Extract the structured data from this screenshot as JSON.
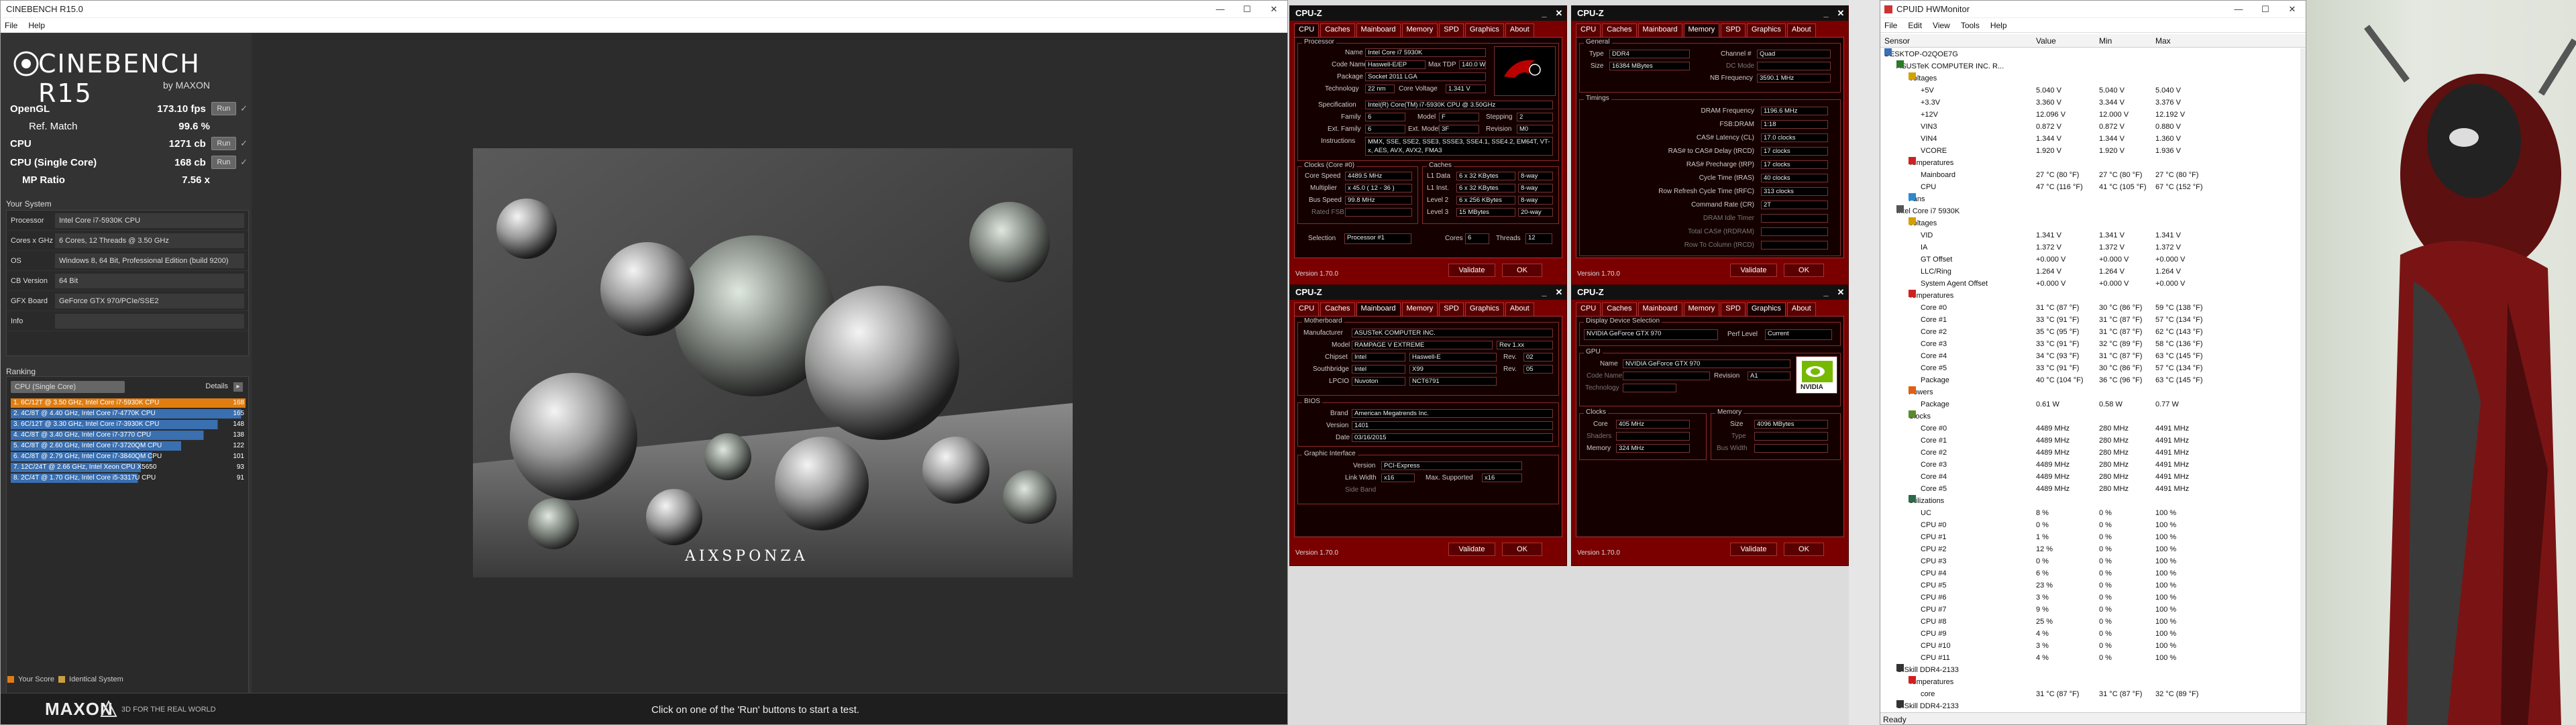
{
  "cinebench": {
    "title": "CINEBENCH R15.0",
    "menu": [
      "File",
      "Help"
    ],
    "logo_main": "CINEBENCH R15",
    "logo_sub": "by MAXON",
    "scores": [
      {
        "label": "OpenGL",
        "value": "173.10 fps",
        "run": "Run"
      },
      {
        "label": "Ref. Match",
        "value": "99.6 %",
        "run": ""
      },
      {
        "label": "CPU",
        "value": "1271 cb",
        "run": "Run"
      },
      {
        "label": "CPU (Single Core)",
        "value": "168 cb",
        "run": "Run"
      },
      {
        "label": "MP Ratio",
        "value": "7.56 x",
        "run": ""
      }
    ],
    "system_header": "Your System",
    "system": [
      {
        "k": "Processor",
        "v": "Intel Core i7-5930K CPU"
      },
      {
        "k": "Cores x GHz",
        "v": "6 Cores, 12 Threads @ 3.50 GHz"
      },
      {
        "k": "OS",
        "v": "Windows 8, 64 Bit, Professional Edition (build 9200)"
      },
      {
        "k": "CB Version",
        "v": "64 Bit"
      },
      {
        "k": "GFX Board",
        "v": "GeForce GTX 970/PCIe/SSE2"
      },
      {
        "k": "Info",
        "v": ""
      }
    ],
    "ranking_header": "Ranking",
    "ranking_select": "CPU (Single Core)",
    "ranking_details": "Details",
    "ranking": [
      {
        "label": "1. 6C/12T @ 3.50 GHz, Intel Core i7-5930K CPU",
        "score": "168",
        "color": "#e07d10"
      },
      {
        "label": "2. 4C/8T @ 4.40 GHz, Intel Core i7-4770K CPU",
        "score": "165",
        "color": "#3a6fb0"
      },
      {
        "label": "3. 6C/12T @ 3.30 GHz, Intel Core i7-3930K CPU",
        "score": "148",
        "color": "#3a6fb0"
      },
      {
        "label": "4. 4C/8T @ 3.40 GHz, Intel Core i7-3770 CPU",
        "score": "138",
        "color": "#3a6fb0"
      },
      {
        "label": "5. 4C/8T @ 2.60 GHz, Intel Core i7-3720QM CPU",
        "score": "122",
        "color": "#3a6fb0"
      },
      {
        "label": "6. 4C/8T @ 2.79 GHz, Intel Core i7-3840QM CPU",
        "score": "101",
        "color": "#3a6fb0"
      },
      {
        "label": "7. 12C/24T @ 2.66 GHz, Intel Xeon CPU X5650",
        "score": "93",
        "color": "#3a6fb0"
      },
      {
        "label": "8. 2C/4T @ 1.70 GHz, Intel Core i5-3317U CPU",
        "score": "91",
        "color": "#3a6fb0"
      }
    ],
    "legend_your": "Your Score",
    "legend_identical": "Identical System",
    "footer_brand": "MAXON",
    "footer_tag": "3D FOR THE REAL WORLD",
    "status": "Click on one of the 'Run' buttons to start a test.",
    "render_brand": "AIXSPONZA"
  },
  "cpuz": {
    "title": "CPU-Z",
    "tabs": [
      "CPU",
      "Caches",
      "Mainboard",
      "Memory",
      "SPD",
      "Graphics",
      "About"
    ],
    "version": "Version 1.70.0",
    "validate": "Validate",
    "ok": "OK",
    "cpu": {
      "proc_label": "Processor",
      "name_k": "Name",
      "name_v": "Intel Core i7 5930K",
      "code_k": "Code Name",
      "code_v": "Haswell-E/EP",
      "tdp_k": "Max TDP",
      "tdp_v": "140.0 W",
      "pkg_k": "Package",
      "pkg_v": "Socket 2011 LGA",
      "tech_k": "Technology",
      "tech_v": "22 nm",
      "cv_k": "Core Voltage",
      "cv_v": "1.341 V",
      "spec_k": "Specification",
      "spec_v": "Intel(R) Core(TM) i7-5930K CPU @ 3.50GHz",
      "fam_k": "Family",
      "fam_v": "6",
      "mod_k": "Model",
      "mod_v": "F",
      "step_k": "Stepping",
      "step_v": "2",
      "efam_k": "Ext. Family",
      "efam_v": "6",
      "emod_k": "Ext. Model",
      "emod_v": "3F",
      "rev_k": "Revision",
      "rev_v": "M0",
      "ins_k": "Instructions",
      "ins_v": "MMX, SSE, SSE2, SSE3, SSSE3, SSE4.1, SSE4.2, EM64T, VT-x, AES, AVX, AVX2, FMA3",
      "clk_label": "Clocks (Core #0)",
      "cache_label": "Caches",
      "cs_k": "Core Speed",
      "cs_v": "4489.5 MHz",
      "mul_k": "Multiplier",
      "mul_v": "x 45.0 ( 12 - 36 )",
      "bus_k": "Bus Speed",
      "bus_v": "99.8 MHz",
      "qpi_k": "Rated FSB",
      "l1d_k": "L1 Data",
      "l1d_v": "6 x 32 KBytes",
      "l1d_w": "8-way",
      "l1i_k": "L1 Inst.",
      "l1i_v": "6 x 32 KBytes",
      "l1i_w": "8-way",
      "l2_k": "Level 2",
      "l2_v": "6 x 256 KBytes",
      "l2_w": "8-way",
      "l3_k": "Level 3",
      "l3_v": "15 MBytes",
      "l3_w": "20-way",
      "sel_k": "Selection",
      "sel_v": "Processor #1",
      "cores_k": "Cores",
      "cores_v": "6",
      "thr_k": "Threads",
      "thr_v": "12"
    },
    "mem": {
      "gen_label": "General",
      "type_k": "Type",
      "type_v": "DDR4",
      "ch_k": "Channel #",
      "ch_v": "Quad",
      "size_k": "Size",
      "size_v": "16384 MBytes",
      "dc_k": "DC Mode",
      "nb_k": "NB Frequency",
      "nb_v": "3590.1 MHz",
      "tim_label": "Timings",
      "rows": [
        {
          "k": "DRAM Frequency",
          "v": "1196.6 MHz"
        },
        {
          "k": "FSB:DRAM",
          "v": "1:18"
        },
        {
          "k": "CAS# Latency (CL)",
          "v": "17.0 clocks"
        },
        {
          "k": "RAS# to CAS# Delay (tRCD)",
          "v": "17 clocks"
        },
        {
          "k": "RAS# Precharge (tRP)",
          "v": "17 clocks"
        },
        {
          "k": "Cycle Time (tRAS)",
          "v": "40 clocks"
        },
        {
          "k": "Row Refresh Cycle Time (tRFC)",
          "v": "313 clocks"
        },
        {
          "k": "Command Rate (CR)",
          "v": "2T"
        },
        {
          "k": "DRAM Idle Timer",
          "v": ""
        },
        {
          "k": "Total CAS# (tRDRAM)",
          "v": ""
        },
        {
          "k": "Row To Column (tRCD)",
          "v": ""
        }
      ]
    },
    "mb": {
      "mb_label": "Motherboard",
      "man_k": "Manufacturer",
      "man_v": "ASUSTeK COMPUTER INC.",
      "model_k": "Model",
      "model_v": "RAMPAGE V EXTREME",
      "model_rev": "Rev 1.xx",
      "chip_k": "Chipset",
      "chip_v": "Intel",
      "chip_v2": "Haswell-E",
      "chip_rk": "Rev.",
      "chip_rv": "02",
      "sb_k": "Southbridge",
      "sb_v": "Intel",
      "sb_v2": "X99",
      "sb_rk": "Rev.",
      "sb_rv": "05",
      "lpc_k": "LPCIO",
      "lpc_v": "Nuvoton",
      "lpc_v2": "NCT6791",
      "bios_label": "BIOS",
      "brand_k": "Brand",
      "brand_v": "American Megatrends Inc.",
      "ver_k": "Version",
      "ver_v": "1401",
      "date_k": "Date",
      "date_v": "03/16/2015",
      "gi_label": "Graphic Interface",
      "gver_k": "Version",
      "gver_v": "PCI-Express",
      "lw_k": "Link Width",
      "lw_v": "x16",
      "ms_k": "Max. Supported",
      "ms_v": "x16",
      "sband_k": "Side Band"
    },
    "gfx": {
      "dds_label": "Display Device Selection",
      "dev_v": "NVIDIA GeForce GTX 970",
      "perf_k": "Perf Level",
      "perf_v": "Current",
      "gpu_label": "GPU",
      "name_k": "Name",
      "name_v": "NVIDIA GeForce GTX 970",
      "code_k": "Code Name",
      "rev_k": "Revision",
      "rev_v": "A1",
      "tech_k": "Technology",
      "clk_label": "Clocks",
      "mem_label": "Memory",
      "core_k": "Core",
      "core_v": "405 MHz",
      "sh_k": "Shaders",
      "memc_k": "Memory",
      "memc_v": "324 MHz",
      "size_k": "Size",
      "size_v": "4096 MBytes",
      "type_k": "Type",
      "bw_k": "Bus Width",
      "logo": "NVIDIA"
    }
  },
  "hwm": {
    "title": "CPUID HWMonitor",
    "menu": [
      "File",
      "Edit",
      "View",
      "Tools",
      "Help"
    ],
    "columns": [
      "Sensor",
      "Value",
      "Min",
      "Max"
    ],
    "status": "Ready",
    "rows": [
      {
        "lv": 0,
        "ic": "pc",
        "n": "DESKTOP-O2QOE7G",
        "v": "",
        "mi": "",
        "ma": ""
      },
      {
        "lv": 1,
        "ic": "mb",
        "n": "ASUSTeK COMPUTER INC. R...",
        "v": "",
        "mi": "",
        "ma": ""
      },
      {
        "lv": 2,
        "ic": "volt",
        "n": "Voltages",
        "v": "",
        "mi": "",
        "ma": ""
      },
      {
        "lv": 3,
        "ic": "",
        "n": "+5V",
        "v": "5.040 V",
        "mi": "5.040 V",
        "ma": "5.040 V"
      },
      {
        "lv": 3,
        "ic": "",
        "n": "+3.3V",
        "v": "3.360 V",
        "mi": "3.344 V",
        "ma": "3.376 V"
      },
      {
        "lv": 3,
        "ic": "",
        "n": "+12V",
        "v": "12.096 V",
        "mi": "12.000 V",
        "ma": "12.192 V"
      },
      {
        "lv": 3,
        "ic": "",
        "n": "VIN3",
        "v": "0.872 V",
        "mi": "0.872 V",
        "ma": "0.880 V"
      },
      {
        "lv": 3,
        "ic": "",
        "n": "VIN4",
        "v": "1.344 V",
        "mi": "1.344 V",
        "ma": "1.360 V"
      },
      {
        "lv": 3,
        "ic": "",
        "n": "VCORE",
        "v": "1.920 V",
        "mi": "1.920 V",
        "ma": "1.936 V"
      },
      {
        "lv": 2,
        "ic": "temp",
        "n": "Temperatures",
        "v": "",
        "mi": "",
        "ma": ""
      },
      {
        "lv": 3,
        "ic": "",
        "n": "Mainboard",
        "v": "27 °C  (80 °F)",
        "mi": "27 °C  (80 °F)",
        "ma": "27 °C  (80 °F)"
      },
      {
        "lv": 3,
        "ic": "",
        "n": "CPU",
        "v": "47 °C  (116 °F)",
        "mi": "41 °C  (105 °F)",
        "ma": "67 °C  (152 °F)"
      },
      {
        "lv": 2,
        "ic": "fan",
        "n": "Fans",
        "v": "",
        "mi": "",
        "ma": ""
      },
      {
        "lv": 1,
        "ic": "cpu",
        "n": "Intel Core i7 5930K",
        "v": "",
        "mi": "",
        "ma": ""
      },
      {
        "lv": 2,
        "ic": "volt",
        "n": "Voltages",
        "v": "",
        "mi": "",
        "ma": ""
      },
      {
        "lv": 3,
        "ic": "",
        "n": "VID",
        "v": "1.341 V",
        "mi": "1.341 V",
        "ma": "1.341 V"
      },
      {
        "lv": 3,
        "ic": "",
        "n": "IA",
        "v": "1.372 V",
        "mi": "1.372 V",
        "ma": "1.372 V"
      },
      {
        "lv": 3,
        "ic": "",
        "n": "GT Offset",
        "v": "+0.000 V",
        "mi": "+0.000 V",
        "ma": "+0.000 V"
      },
      {
        "lv": 3,
        "ic": "",
        "n": "LLC/Ring",
        "v": "1.264 V",
        "mi": "1.264 V",
        "ma": "1.264 V"
      },
      {
        "lv": 3,
        "ic": "",
        "n": "System Agent Offset",
        "v": "+0.000 V",
        "mi": "+0.000 V",
        "ma": "+0.000 V"
      },
      {
        "lv": 2,
        "ic": "temp",
        "n": "Temperatures",
        "v": "",
        "mi": "",
        "ma": ""
      },
      {
        "lv": 3,
        "ic": "",
        "n": "Core #0",
        "v": "31 °C  (87 °F)",
        "mi": "30 °C  (86 °F)",
        "ma": "59 °C  (138 °F)"
      },
      {
        "lv": 3,
        "ic": "",
        "n": "Core #1",
        "v": "33 °C  (91 °F)",
        "mi": "31 °C  (87 °F)",
        "ma": "57 °C  (134 °F)"
      },
      {
        "lv": 3,
        "ic": "",
        "n": "Core #2",
        "v": "35 °C  (95 °F)",
        "mi": "31 °C  (87 °F)",
        "ma": "62 °C  (143 °F)"
      },
      {
        "lv": 3,
        "ic": "",
        "n": "Core #3",
        "v": "33 °C  (91 °F)",
        "mi": "32 °C  (89 °F)",
        "ma": "58 °C  (136 °F)"
      },
      {
        "lv": 3,
        "ic": "",
        "n": "Core #4",
        "v": "34 °C  (93 °F)",
        "mi": "31 °C  (87 °F)",
        "ma": "63 °C  (145 °F)"
      },
      {
        "lv": 3,
        "ic": "",
        "n": "Core #5",
        "v": "33 °C  (91 °F)",
        "mi": "30 °C  (86 °F)",
        "ma": "57 °C  (134 °F)"
      },
      {
        "lv": 3,
        "ic": "",
        "n": "Package",
        "v": "40 °C  (104 °F)",
        "mi": "36 °C  (96 °F)",
        "ma": "63 °C  (145 °F)"
      },
      {
        "lv": 2,
        "ic": "pow",
        "n": "Powers",
        "v": "",
        "mi": "",
        "ma": ""
      },
      {
        "lv": 3,
        "ic": "",
        "n": "Package",
        "v": "0.61 W",
        "mi": "0.58 W",
        "ma": "0.77 W"
      },
      {
        "lv": 2,
        "ic": "clk",
        "n": "Clocks",
        "v": "",
        "mi": "",
        "ma": ""
      },
      {
        "lv": 3,
        "ic": "",
        "n": "Core #0",
        "v": "4489 MHz",
        "mi": "280 MHz",
        "ma": "4491 MHz"
      },
      {
        "lv": 3,
        "ic": "",
        "n": "Core #1",
        "v": "4489 MHz",
        "mi": "280 MHz",
        "ma": "4491 MHz"
      },
      {
        "lv": 3,
        "ic": "",
        "n": "Core #2",
        "v": "4489 MHz",
        "mi": "280 MHz",
        "ma": "4491 MHz"
      },
      {
        "lv": 3,
        "ic": "",
        "n": "Core #3",
        "v": "4489 MHz",
        "mi": "280 MHz",
        "ma": "4491 MHz"
      },
      {
        "lv": 3,
        "ic": "",
        "n": "Core #4",
        "v": "4489 MHz",
        "mi": "280 MHz",
        "ma": "4491 MHz"
      },
      {
        "lv": 3,
        "ic": "",
        "n": "Core #5",
        "v": "4489 MHz",
        "mi": "280 MHz",
        "ma": "4491 MHz"
      },
      {
        "lv": 2,
        "ic": "util",
        "n": "Utilizations",
        "v": "",
        "mi": "",
        "ma": ""
      },
      {
        "lv": 3,
        "ic": "",
        "n": "UC",
        "v": "8 %",
        "mi": "0 %",
        "ma": "100 %"
      },
      {
        "lv": 3,
        "ic": "",
        "n": "CPU #0",
        "v": "0 %",
        "mi": "0 %",
        "ma": "100 %"
      },
      {
        "lv": 3,
        "ic": "",
        "n": "CPU #1",
        "v": "1 %",
        "mi": "0 %",
        "ma": "100 %"
      },
      {
        "lv": 3,
        "ic": "",
        "n": "CPU #2",
        "v": "12 %",
        "mi": "0 %",
        "ma": "100 %"
      },
      {
        "lv": 3,
        "ic": "",
        "n": "CPU #3",
        "v": "0 %",
        "mi": "0 %",
        "ma": "100 %"
      },
      {
        "lv": 3,
        "ic": "",
        "n": "CPU #4",
        "v": "6 %",
        "mi": "0 %",
        "ma": "100 %"
      },
      {
        "lv": 3,
        "ic": "",
        "n": "CPU #5",
        "v": "23 %",
        "mi": "0 %",
        "ma": "100 %"
      },
      {
        "lv": 3,
        "ic": "",
        "n": "CPU #6",
        "v": "3 %",
        "mi": "0 %",
        "ma": "100 %"
      },
      {
        "lv": 3,
        "ic": "",
        "n": "CPU #7",
        "v": "9 %",
        "mi": "0 %",
        "ma": "100 %"
      },
      {
        "lv": 3,
        "ic": "",
        "n": "CPU #8",
        "v": "25 %",
        "mi": "0 %",
        "ma": "100 %"
      },
      {
        "lv": 3,
        "ic": "",
        "n": "CPU #9",
        "v": "4 %",
        "mi": "0 %",
        "ma": "100 %"
      },
      {
        "lv": 3,
        "ic": "",
        "n": "CPU #10",
        "v": "3 %",
        "mi": "0 %",
        "ma": "100 %"
      },
      {
        "lv": 3,
        "ic": "",
        "n": "CPU #11",
        "v": "4 %",
        "mi": "0 %",
        "ma": "100 %"
      },
      {
        "lv": 1,
        "ic": "ram",
        "n": "G.Skill DDR4-2133",
        "v": "",
        "mi": "",
        "ma": ""
      },
      {
        "lv": 2,
        "ic": "temp",
        "n": "Temperatures",
        "v": "",
        "mi": "",
        "ma": ""
      },
      {
        "lv": 3,
        "ic": "",
        "n": "core",
        "v": "31 °C  (87 °F)",
        "mi": "31 °C  (87 °F)",
        "ma": "32 °C  (89 °F)"
      },
      {
        "lv": 1,
        "ic": "ram",
        "n": "G.Skill DDR4-2133",
        "v": "",
        "mi": "",
        "ma": ""
      }
    ]
  }
}
